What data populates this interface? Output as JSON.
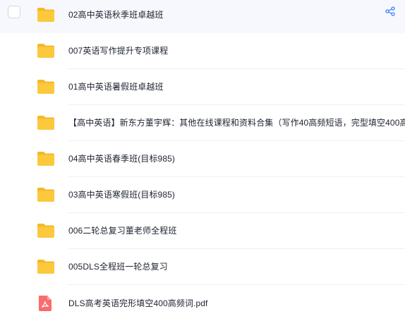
{
  "files": [
    {
      "name": "02高中英语秋季班卓越班",
      "type": "folder"
    },
    {
      "name": "007英语写作提升专项课程",
      "type": "folder"
    },
    {
      "name": "01高中英语暑假班卓越班",
      "type": "folder"
    },
    {
      "name": "【高中英语】新东方董宇辉：其他在线课程和资料合集（写作40高频短语，完型填空400高",
      "type": "folder"
    },
    {
      "name": "04高中英语春季班(目标985)",
      "type": "folder"
    },
    {
      "name": "03高中英语寒假班(目标985)",
      "type": "folder"
    },
    {
      "name": "006二轮总复习董老师全程班",
      "type": "folder"
    },
    {
      "name": "005DLS全程班一轮总复习",
      "type": "folder"
    },
    {
      "name": "DLS高考英语完形填空400高频词.pdf",
      "type": "pdf"
    }
  ],
  "icons": {
    "folder": "folder-icon",
    "pdf": "pdf-file-icon",
    "share": "share-icon"
  },
  "colors": {
    "folder": "#fcc93d",
    "folder_tab": "#f5b82a",
    "pdf": "#fa6b6b",
    "share_accent": "#3d7fff",
    "hover_row": "#f6f8fd"
  }
}
